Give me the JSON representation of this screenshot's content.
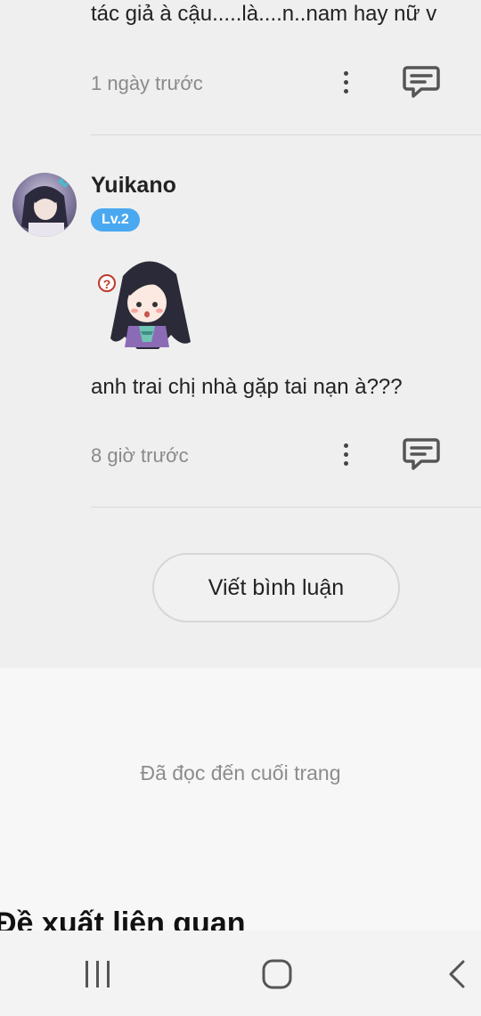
{
  "comments": [
    {
      "text": "tác giả à cậu.....là....n..nam hay nữ v",
      "timestamp": "1 ngày trước"
    },
    {
      "username": "Yuikano",
      "level": "Lv.2",
      "text": "anh trai chị nhà gặp tai nạn à???",
      "timestamp": "8 giờ trước"
    }
  ],
  "write_comment_label": "Viết bình luận",
  "end_of_page_text": "Đã đọc đến cuối trang",
  "related_title": "Đề xuất liên quan",
  "colors": {
    "level_badge": "#4aa8f0",
    "comment_background": "#efefef",
    "page_background": "#f7f7f7"
  },
  "icons": {
    "more": "more-vertical-icon",
    "reply": "comment-reply-icon",
    "nav_recent": "recent-apps-icon",
    "nav_home": "home-icon",
    "nav_back": "back-icon"
  }
}
